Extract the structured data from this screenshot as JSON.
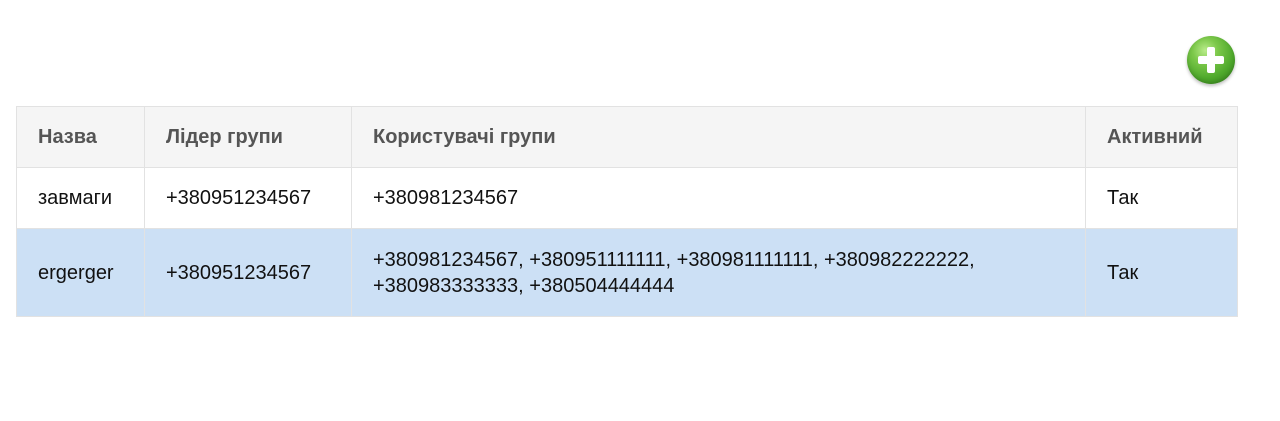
{
  "toolbar": {
    "add_icon": "plus-circle-icon",
    "add_color": "#4fa92c"
  },
  "table": {
    "columns": [
      "Назва",
      "Лідер групи",
      "Користувачі групи",
      "Активний"
    ],
    "rows": [
      {
        "name": "завмаги",
        "leader": "+380951234567",
        "users_line1": "+380981234567",
        "users_line2": "",
        "active": "Так"
      },
      {
        "name": "ergerger",
        "leader": "+380951234567",
        "users_line1": "+380981234567, +380951111111, +380981111111, +380982222222,",
        "users_line2": "+380983333333, +380504444444",
        "active": "Так"
      }
    ],
    "selected_row_color": "#cce0f5",
    "header_bg": "#f5f5f5"
  }
}
